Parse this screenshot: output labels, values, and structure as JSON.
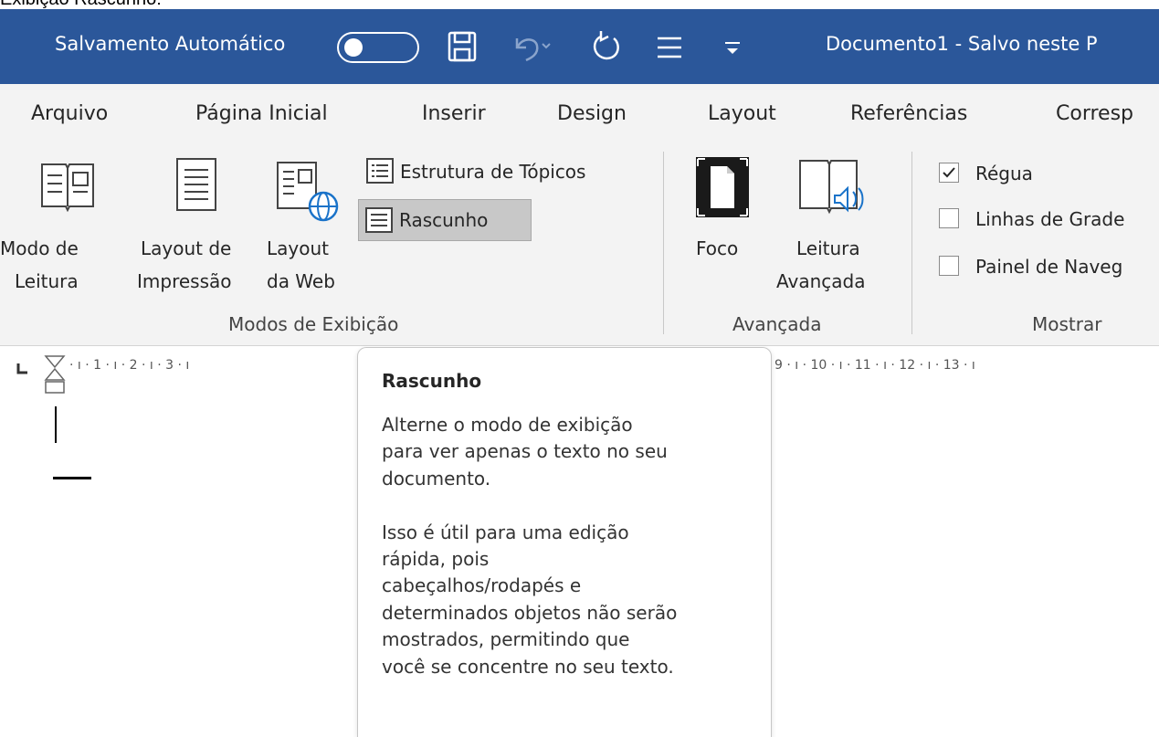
{
  "caption": "Exibição Rascunho:",
  "titlebar": {
    "autosave_label": "Salvamento Automático",
    "autosave_state": "off",
    "document_title": "Documento1  -  Salvo neste P",
    "icons": [
      "save-icon",
      "undo-icon",
      "redo-icon",
      "touch-mode-icon",
      "customize-qat-icon"
    ]
  },
  "tabs": [
    "Arquivo",
    "Página Inicial",
    "Inserir",
    "Design",
    "Layout",
    "Referências",
    "Corresp"
  ],
  "ribbon": {
    "modes": {
      "reading_mode": [
        "Modo de",
        "Leitura"
      ],
      "print_layout": [
        "Layout de",
        "Impressão"
      ],
      "web_layout": [
        "Layout",
        "da Web"
      ],
      "outline": "Estrutura de Tópicos",
      "draft": "Rascunho",
      "group_label": "Modos de Exibição"
    },
    "advanced": {
      "focus": "Foco",
      "reader": [
        "Leitura",
        "Avançada"
      ],
      "group_label": "Avançada"
    },
    "show": {
      "ruler": "Régua",
      "ruler_checked": true,
      "gridlines": "Linhas de Grade",
      "gridlines_checked": false,
      "nav_pane": "Painel de Naveg",
      "nav_pane_checked": false,
      "group_label": "Mostrar"
    }
  },
  "ruler": {
    "left_marks": "·  ı  ·  1  ·  ı  ·  2  ·  ı  ·  3  ·  ı",
    "right_marks": "9  ·  ı  ·  10  ·  ı  ·  11  ·  ı  ·  12  ·  ı  ·  13  ·  ı"
  },
  "tooltip": {
    "title": "Rascunho",
    "body": "Alterne o modo de exibição\npara ver apenas o texto no seu\ndocumento.\n\nIsso é útil para uma edição\nrápida, pois\ncabeçalhos/rodapés e\ndeterminados objetos não serão\nmostrados, permitindo que\nvocê se concentre no seu texto."
  }
}
